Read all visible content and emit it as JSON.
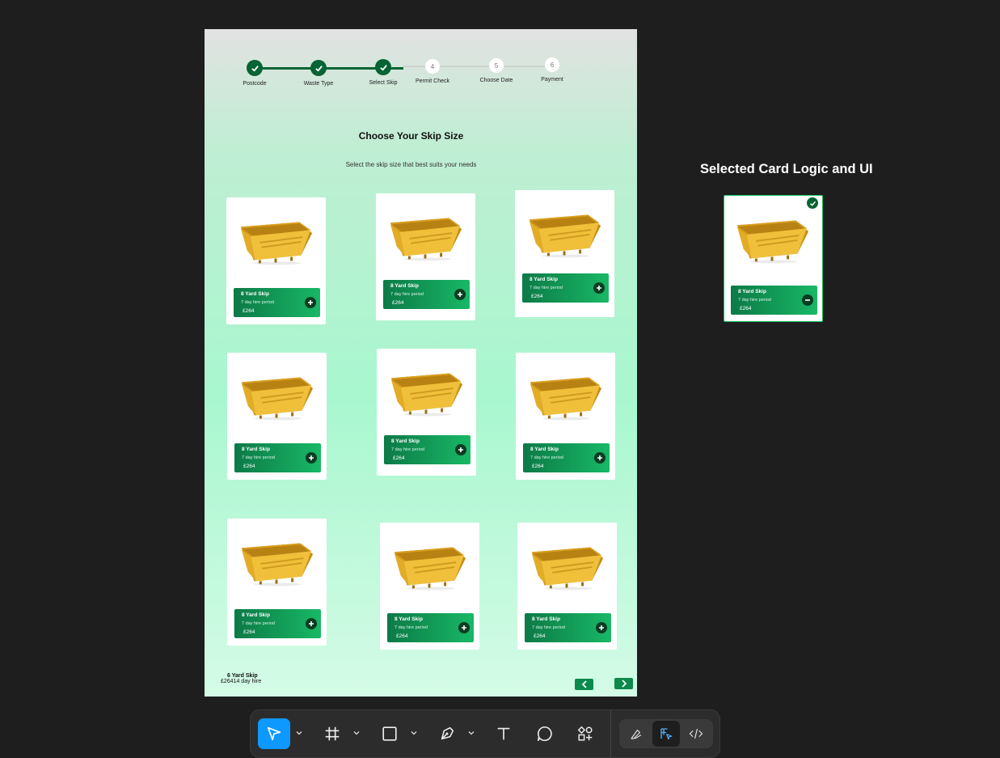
{
  "steps": [
    {
      "label": "Postcode",
      "state": "done"
    },
    {
      "label": "Waste Type",
      "state": "done"
    },
    {
      "label": "Select Skip",
      "state": "done"
    },
    {
      "label": "Permit Check",
      "state": "todo",
      "num": "4"
    },
    {
      "label": "Choose Date",
      "state": "todo",
      "num": "5"
    },
    {
      "label": "Payment",
      "state": "todo",
      "num": "6"
    }
  ],
  "heading": {
    "title": "Choose Your Skip Size",
    "subtitle": "Select the skip size that best suits your needs"
  },
  "cards": [
    {
      "name": "8 Yard Skip",
      "hire": "7 day hire period",
      "price": "£264"
    },
    {
      "name": "8 Yard Skip",
      "hire": "7 day hire period",
      "price": "£264"
    },
    {
      "name": "8 Yard Skip",
      "hire": "7 day hire period",
      "price": "£264"
    },
    {
      "name": "8 Yard Skip",
      "hire": "7 day hire period",
      "price": "£264"
    },
    {
      "name": "8 Yard Skip",
      "hire": "7 day hire period",
      "price": "£264"
    },
    {
      "name": "8 Yard Skip",
      "hire": "7 day hire period",
      "price": "£264"
    },
    {
      "name": "8 Yard Skip",
      "hire": "7 day hire period",
      "price": "£264"
    },
    {
      "name": "8 Yard Skip",
      "hire": "7 day hire period",
      "price": "£264"
    },
    {
      "name": "8 Yard Skip",
      "hire": "7 day hire period",
      "price": "£264"
    }
  ],
  "footer": {
    "selected_name": "6 Yard Skip",
    "selected_detail": "£26414 day hire",
    "prev_icon": "chevron-left-icon",
    "next_icon": "chevron-right-icon"
  },
  "selected_panel": {
    "title": "Selected Card Logic and UI",
    "card": {
      "name": "8 Yard Skip",
      "hire": "7 day hire period",
      "price": "£264"
    }
  },
  "colors": {
    "brand_dark": "#046433",
    "brand_gradient_start": "#0c7a47",
    "brand_gradient_end": "#18b866",
    "skip_yellow": "#e6b127",
    "toolbar_active": "#0d99ff"
  },
  "toolbar": {
    "tools": [
      "move-icon",
      "frame-icon",
      "rectangle-icon",
      "pen-icon",
      "text-icon",
      "comment-icon",
      "actions-icon"
    ],
    "modes": [
      "draw-mode-icon",
      "design-mode-icon",
      "dev-mode-icon"
    ]
  }
}
